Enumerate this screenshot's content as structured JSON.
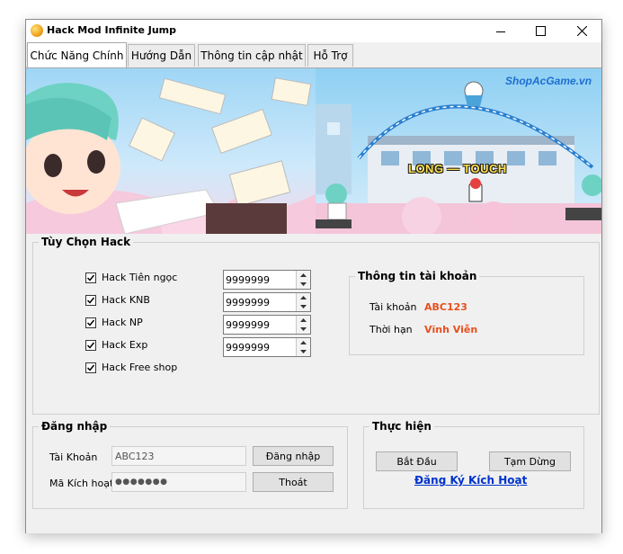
{
  "window": {
    "title": "Hack Mod Infinite Jump"
  },
  "tabs": [
    "Chức Năng Chính",
    "Hướng Dẫn",
    "Thông tin cập nhật",
    "Hỗ Trợ"
  ],
  "banner": {
    "watermark": "ShopAcGame.vn",
    "caption": "LONG — TOUCH"
  },
  "hack_options": {
    "legend": "Tùy Chọn Hack",
    "items": [
      {
        "label": "Hack Tiên ngọc",
        "checked": true,
        "value": "9999999"
      },
      {
        "label": "Hack KNB",
        "checked": true,
        "value": "9999999"
      },
      {
        "label": "Hack NP",
        "checked": true,
        "value": "9999999"
      },
      {
        "label": "Hack Exp",
        "checked": true,
        "value": "9999999"
      },
      {
        "label": "Hack Free shop",
        "checked": true
      }
    ]
  },
  "account_info": {
    "legend": "Thông tin tài khoản",
    "account_label": "Tài khoản",
    "account_value": "ABC123",
    "expiry_label": "Thời hạn",
    "expiry_value": "Vĩnh Viễn",
    "value_color": "#e8501e"
  },
  "login": {
    "legend": "Đăng nhập",
    "account_label": "Tài Khoản",
    "account_value": "ABC123",
    "key_label": "Mã Kích hoạt",
    "key_value": "●●●●●●●",
    "login_button": "Đăng nhập",
    "exit_button": "Thoát"
  },
  "actions": {
    "legend": "Thực hiện",
    "start_button": "Bắt Đầu",
    "pause_button": "Tạm Dừng",
    "register_link": "Đăng Ký Kích Hoạt",
    "link_color": "#0033cc"
  }
}
